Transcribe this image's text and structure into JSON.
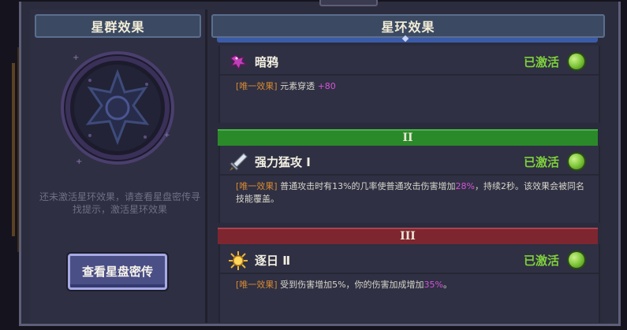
{
  "left_panel": {
    "title": "星群效果",
    "hint": "还未激活星环效果，请查看星盘密传寻找提示，激活星环效果",
    "button_label": "查看星盘密传"
  },
  "right_panel": {
    "title": "星环效果",
    "effects": [
      {
        "icon": "raven-icon",
        "name": "暗鸦",
        "status": "已激活",
        "desc_tag": "[唯一效果]",
        "desc_pre": " 元素穿透 ",
        "desc_highlight": "+80",
        "desc_post": ""
      },
      {
        "tier": "II",
        "icon": "sword-icon",
        "name": "强力猛攻 Ⅰ",
        "status": "已激活",
        "desc_tag": "[唯一效果]",
        "desc_pre": " 普通攻击时有13%的几率使普通攻击伤害增加",
        "desc_highlight": "28%",
        "desc_post": "，持续2秒。该效果会被同名技能覆盖。"
      },
      {
        "tier": "III",
        "icon": "sun-icon",
        "name": "逐日 Ⅱ",
        "status": "已激活",
        "desc_tag": "[唯一效果]",
        "desc_pre": " 受到伤害增加5%，你的伤害加成增加",
        "desc_highlight": "35%",
        "desc_post": "。"
      }
    ]
  },
  "colors": {
    "active_green": "#7fd13c",
    "tag_orange": "#d78a34",
    "highlight_purple": "#d454d8",
    "tier2_green": "#2a8a2a",
    "tier3_red": "#7d2630"
  }
}
